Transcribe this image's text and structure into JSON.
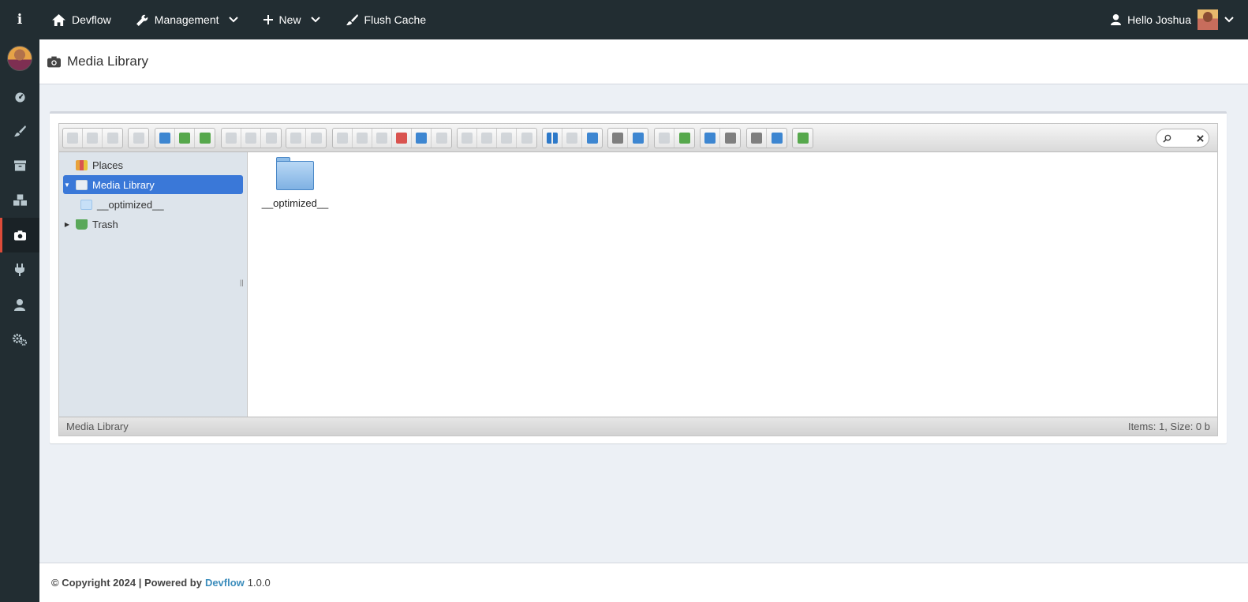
{
  "sidebar": {
    "info_label": "i",
    "items": [
      {
        "icon": "dashboard-icon"
      },
      {
        "icon": "brush-icon"
      },
      {
        "icon": "archive-icon"
      },
      {
        "icon": "cubes-icon"
      },
      {
        "icon": "camera-icon",
        "active": true
      },
      {
        "icon": "plug-icon"
      },
      {
        "icon": "user-icon"
      },
      {
        "icon": "gears-icon"
      }
    ]
  },
  "topbar": {
    "home_label": "Devflow",
    "management_label": "Management",
    "new_label": "New",
    "flush_label": "Flush Cache",
    "greeting": "Hello Joshua"
  },
  "header": {
    "title": "Media Library"
  },
  "filemanager": {
    "tree": {
      "places": "Places",
      "media_library": "Media Library",
      "optimized": "__optimized__",
      "trash": "Trash"
    },
    "files": [
      {
        "name": "__optimized__",
        "type": "folder"
      }
    ],
    "status_left": "Media Library",
    "status_right": "Items: 1, Size: 0 b"
  },
  "footer": {
    "copyright": "© Copyright 2024 | Powered by",
    "brand": "Devflow",
    "version": "1.0.0"
  },
  "colors": {
    "sidebar_bg": "#222d32",
    "active_accent": "#dd4b39",
    "selection_blue": "#3a78d8",
    "link_blue": "#3c8dbc"
  }
}
